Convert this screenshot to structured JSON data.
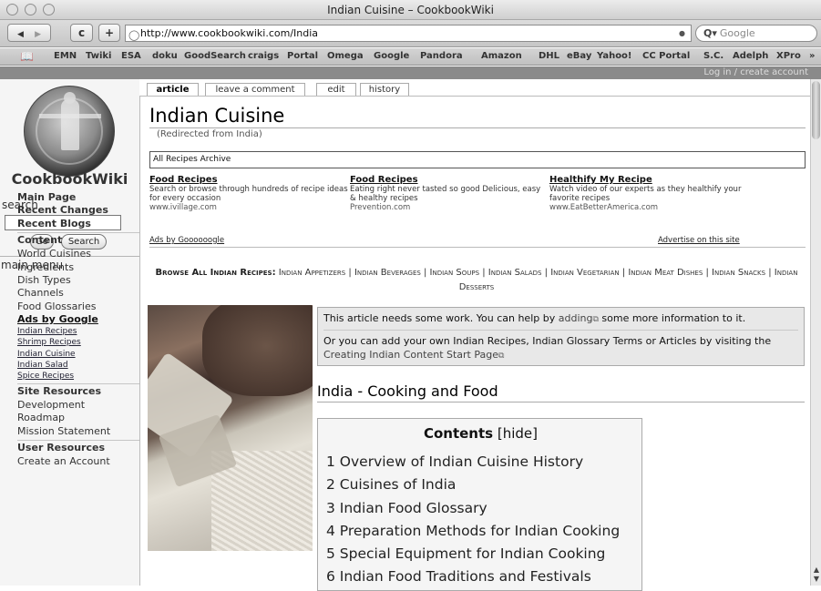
{
  "window": {
    "title": "Indian Cuisine – CookbookWiki"
  },
  "toolbar": {
    "back": "◀",
    "forward": "▶",
    "reload": "c",
    "add": "+",
    "url": "http://www.cookbookwiki.com/India",
    "search_placeholder": "Google",
    "search_icon": "Q▾"
  },
  "bookmarks": [
    "EMN",
    "Twiki",
    "ESA",
    "doku",
    "GoodSearch",
    "craigs",
    "Portal",
    "Omega",
    "Google",
    "Pandora",
    "Amazon",
    "DHL",
    "eBay",
    "Yahoo!",
    "CC Portal",
    "S.C.",
    "Adelph",
    "XPro"
  ],
  "bookmarks_more": "»",
  "login": "Log in / create account",
  "sidebar": {
    "site_name": "CookbookWiki",
    "search_label": "search",
    "go_button": "Go",
    "search_button": "Search",
    "main_menu_label": "main menu",
    "items": [
      {
        "label": "Main Page",
        "style": "b"
      },
      {
        "label": "Recent Changes",
        "style": "b"
      },
      {
        "label": "Recent Blogs",
        "style": "b"
      },
      {
        "label": "Content",
        "style": "hdr"
      },
      {
        "label": "World Cuisines",
        "style": ""
      },
      {
        "label": "Ingredients",
        "style": ""
      },
      {
        "label": "Dish Types",
        "style": ""
      },
      {
        "label": "Channels",
        "style": ""
      },
      {
        "label": "Food Glossaries",
        "style": ""
      },
      {
        "label": "Ads by Google",
        "style": "ads"
      },
      {
        "label": "Indian Recipes",
        "style": "adl"
      },
      {
        "label": "Shrimp Recipes",
        "style": "adl"
      },
      {
        "label": "Indian Cuisine",
        "style": "adl"
      },
      {
        "label": "Indian Salad",
        "style": "adl"
      },
      {
        "label": "Spice Recipes",
        "style": "adl"
      },
      {
        "label": "Site Resources",
        "style": "hdr"
      },
      {
        "label": "Development",
        "style": ""
      },
      {
        "label": "Roadmap",
        "style": ""
      },
      {
        "label": "Mission Statement",
        "style": ""
      },
      {
        "label": "User Resources",
        "style": "hdr"
      },
      {
        "label": "Create an Account",
        "style": ""
      }
    ]
  },
  "tabs": [
    "article",
    "leave a comment",
    "edit",
    "history"
  ],
  "page": {
    "title": "Indian Cuisine",
    "redirect_prefix": "(Redirected from ",
    "redirect_link": "India",
    "redirect_suffix": ")",
    "archive_label": "All Recipes Archive"
  },
  "ads": [
    {
      "title": "Food Recipes",
      "text": "Search or browse through hundreds of recipe ideas for every occasion",
      "url": "www.ivillage.com"
    },
    {
      "title": "Food Recipes",
      "text": "Eating right never tasted so good Delicious, easy & healthy recipes",
      "url": "Prevention.com"
    },
    {
      "title": "Healthify My Recipe",
      "text": "Watch video of our experts as they healthify your favorite recipes",
      "url": "www.EatBetterAmerica.com"
    }
  ],
  "ads_by": "Ads by Goooooogle",
  "advertise": "Advertise on this site",
  "browse": {
    "label": "Browse All Indian Recipes:",
    "links": [
      "Indian Appetizers",
      "Indian Beverages",
      "Indian Soups",
      "Indian Salads",
      "Indian Vegetarian",
      "Indian Meat Dishes",
      "Indian Snacks",
      "Indian Desserts"
    ],
    "separator": " | "
  },
  "notice": {
    "line1_a": "This article needs some work. You can help by ",
    "line1_link": "adding",
    "line1_b": " some more information to it.",
    "line2": "Or you can add your own Indian Recipes, Indian Glossary Terms or Articles by visiting the",
    "line3": "Creating Indian Content Start Page",
    "ext_icon": "⧉"
  },
  "section_heading": "India - Cooking and Food",
  "toc": {
    "title": "Contents",
    "hide": "[hide]",
    "items": [
      "1 Overview of Indian Cuisine History",
      "2 Cuisines of India",
      "3 Indian Food Glossary",
      "4 Preparation Methods for Indian Cooking",
      "5 Special Equipment for Indian Cooking",
      "6 Indian Food Traditions and Festivals"
    ]
  }
}
